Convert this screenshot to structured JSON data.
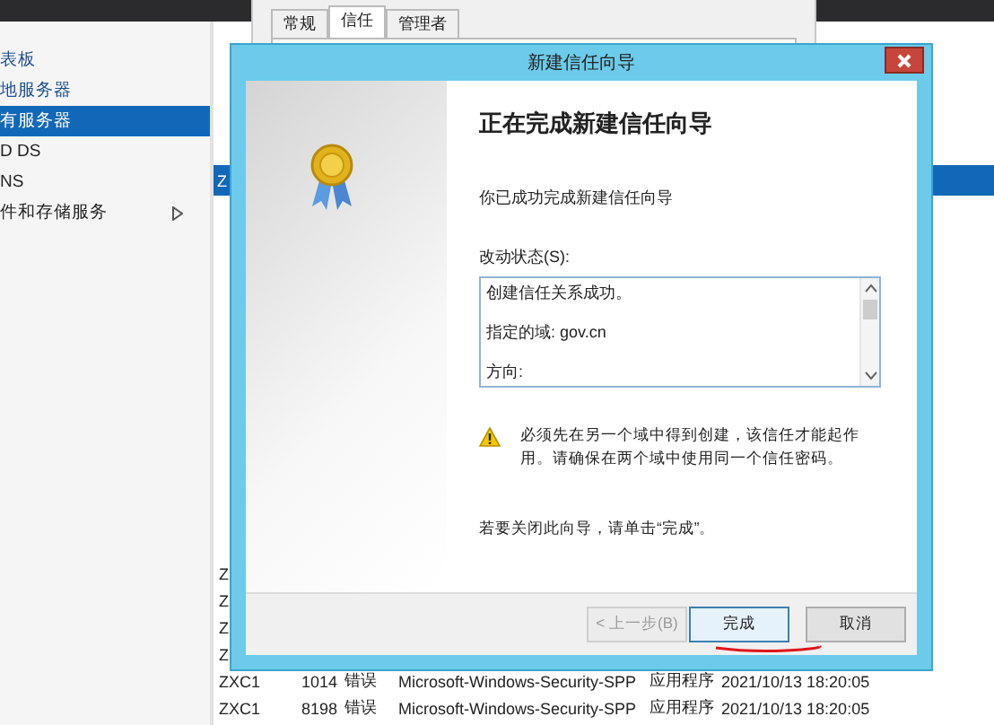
{
  "sidebar": {
    "items": [
      {
        "label": "表板",
        "selected": false,
        "has_arrow": false
      },
      {
        "label": "地服务器",
        "selected": false,
        "has_arrow": false
      },
      {
        "label": "有服务器",
        "selected": true,
        "has_arrow": false
      },
      {
        "label": "D DS",
        "selected": false,
        "has_arrow": false
      },
      {
        "label": "NS",
        "selected": false,
        "has_arrow": false
      },
      {
        "label": "件和存储服务",
        "selected": false,
        "has_arrow": true
      }
    ]
  },
  "properties_window": {
    "tabs": [
      {
        "label": "常规",
        "selected": false
      },
      {
        "label": "信任",
        "selected": true
      },
      {
        "label": "管理者",
        "selected": false
      }
    ]
  },
  "main_pane": {
    "selected_row": "Z",
    "partial_rows": [
      "Z",
      "Z",
      "Z",
      "Z"
    ],
    "event_rows": [
      [
        "ZXC1",
        "1014",
        "错误",
        "Microsoft-Windows-Security-SPP",
        "应用程序",
        "2021/10/13 18:20:05"
      ],
      [
        "ZXC1",
        "8198",
        "错误",
        "Microsoft-Windows-Security-SPP",
        "应用程序",
        "2021/10/13 18:20:05"
      ]
    ]
  },
  "dialog": {
    "title": "新建信任向导",
    "heading": "正在完成新建信任向导",
    "intro": "你已成功完成新建信任向导",
    "status_label": "改动状态(S):",
    "status_lines": [
      "创建信任关系成功。",
      "指定的域: gov.cn",
      "方向:"
    ],
    "warning": "必须先在另一个域中得到创建，该信任才能起作用。请确保在两个域中使用同一个信任密码。",
    "closing": "若要关闭此向导，请单击“完成”。",
    "buttons": [
      {
        "label": "< 上一步(B)",
        "disabled": true,
        "default": false
      },
      {
        "label": "完成",
        "disabled": false,
        "default": true
      },
      {
        "label": "取消",
        "disabled": false,
        "default": false
      }
    ]
  }
}
